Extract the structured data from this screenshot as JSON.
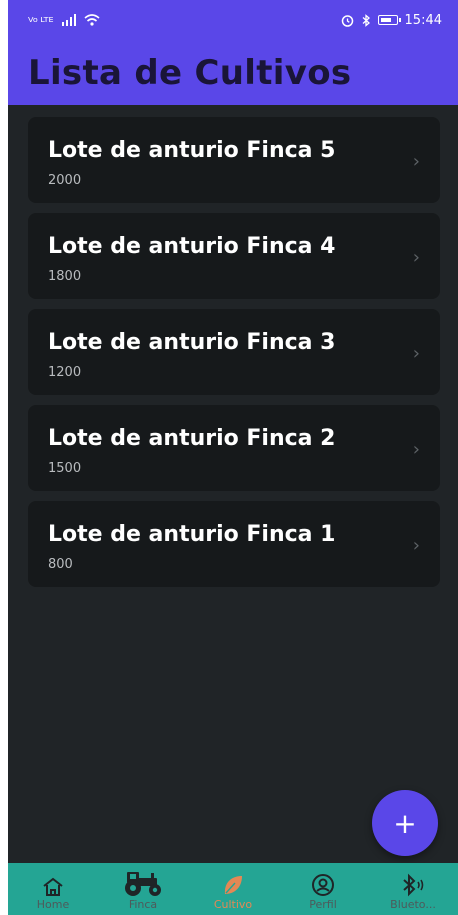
{
  "status_bar": {
    "network": "Vo LTE",
    "time": "15:44"
  },
  "app_bar": {
    "title": "Lista de Cultivos"
  },
  "crops": [
    {
      "name": "Lote de anturio Finca 5",
      "quantity": "2000"
    },
    {
      "name": "Lote de anturio Finca 4",
      "quantity": "1800"
    },
    {
      "name": "Lote de anturio Finca 3",
      "quantity": "1200"
    },
    {
      "name": "Lote de anturio Finca 2",
      "quantity": "1500"
    },
    {
      "name": "Lote de anturio Finca 1",
      "quantity": "800"
    }
  ],
  "fab": {
    "label": "+"
  },
  "bottom_nav": {
    "active": "Cultivo",
    "items": [
      {
        "label": "Home",
        "icon": "home-icon"
      },
      {
        "label": "Finca",
        "icon": "tractor-icon"
      },
      {
        "label": "Cultivo",
        "icon": "leaf-icon"
      },
      {
        "label": "Perfil",
        "icon": "profile-icon"
      },
      {
        "label": "Blueto...",
        "icon": "bluetooth-icon"
      }
    ]
  },
  "colors": {
    "primary": "#5a47e8",
    "background": "#202427",
    "card": "#16191b",
    "nav": "#24a594",
    "active": "#e48855"
  }
}
